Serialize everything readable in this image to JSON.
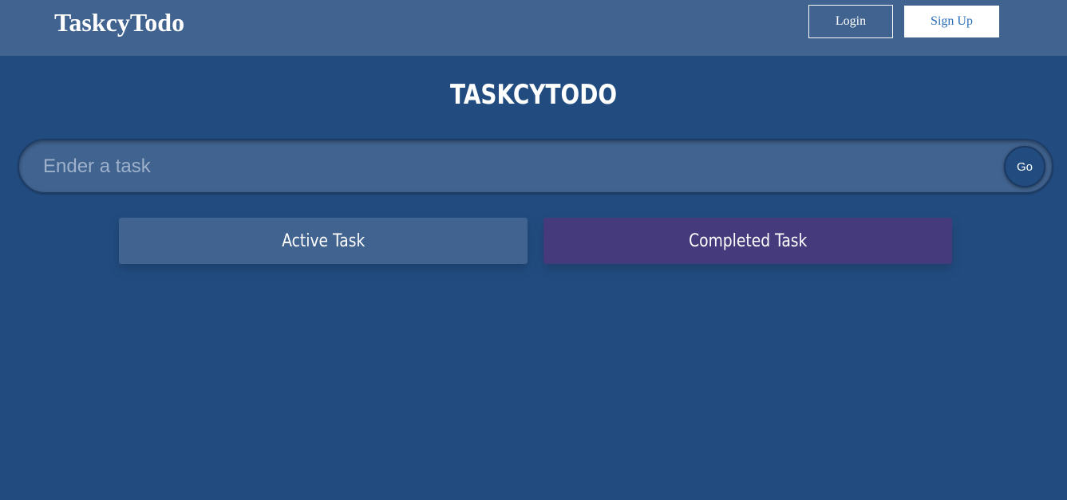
{
  "navbar": {
    "brand": "TaskcyTodo",
    "login_label": "Login",
    "signup_label": "Sign Up"
  },
  "main": {
    "title": "TASKCYTODO",
    "task_input": {
      "placeholder": "Ender a task",
      "value": ""
    },
    "go_label": "Go",
    "tabs": [
      {
        "label": "Active Task"
      },
      {
        "label": "Completed Task"
      }
    ]
  },
  "colors": {
    "page_background": "#224c80",
    "navbar_background": "#41638f",
    "active_tab": "#41638f",
    "completed_tab": "#453a7c",
    "signup_text": "#2a6db5"
  }
}
